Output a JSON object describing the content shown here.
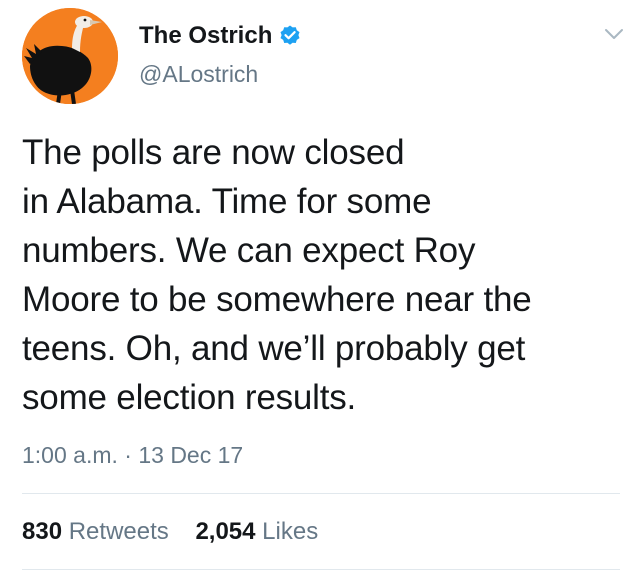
{
  "author": {
    "display_name": "The Ostrich",
    "handle": "@ALostrich",
    "verified": true,
    "avatar_icon": "ostrich-avatar-icon"
  },
  "tweet": {
    "text": "The polls are now closed\nin Alabama. Time for some\nnumbers. We can expect Roy\nMoore to be somewhere near the\nteens. Oh, and we’ll probably get\nsome election results.",
    "time": "1:00 a.m.",
    "separator": "·",
    "date": "13 Dec 17"
  },
  "stats": {
    "retweets_count": "830",
    "retweets_label": "Retweets",
    "likes_count": "2,054",
    "likes_label": "Likes"
  },
  "colors": {
    "verified_blue": "#1da1f2",
    "secondary_text": "#657786",
    "primary_text": "#14171a",
    "avatar_bg": "#f47f1f",
    "divider": "#e1e8ed"
  }
}
